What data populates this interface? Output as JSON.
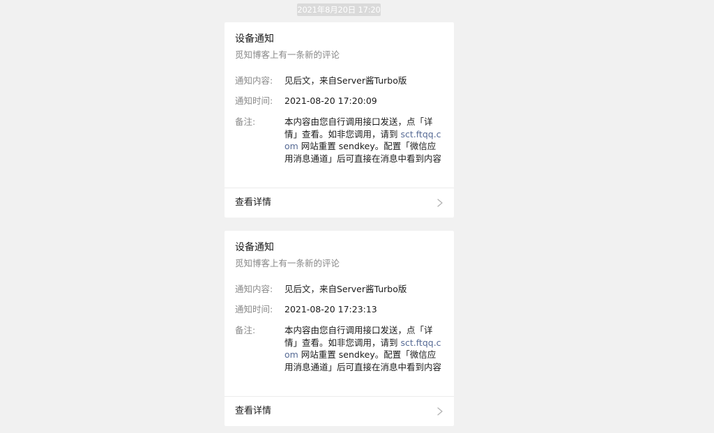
{
  "timestamp": "2021年8月20日 17:20",
  "cards": [
    {
      "title": "设备通知",
      "subtitle": "觅知博客上有一条新的评论",
      "content_label": "通知内容:",
      "content_value": "见后文，来自Server酱Turbo版",
      "time_label": "通知时间:",
      "time_value": "2021-08-20 17:20:09",
      "note_label": "备注:",
      "note_text_1": "本内容由您自行调用接口发送，点「详情」查看。如非您调用，请到 ",
      "note_link": "sct.ftqq.com",
      "note_text_2": " 网站重置 sendkey。配置「微信应用消息通道」后可直接在消息中看到内容",
      "detail_label": "查看详情"
    },
    {
      "title": "设备通知",
      "subtitle": "觅知博客上有一条新的评论",
      "content_label": "通知内容:",
      "content_value": "见后文，来自Server酱Turbo版",
      "time_label": "通知时间:",
      "time_value": "2021-08-20 17:23:13",
      "note_label": "备注:",
      "note_text_1": "本内容由您自行调用接口发送，点「详情」查看。如非您调用，请到 ",
      "note_link": "sct.ftqq.com",
      "note_text_2": " 网站重置 sendkey。配置「微信应用消息通道」后可直接在消息中看到内容",
      "detail_label": "查看详情"
    }
  ],
  "colors": {
    "background": "#f1f1f1",
    "card": "#ffffff",
    "link": "#576b95",
    "label": "#8a8a8a",
    "timestamp_bg": "#dadada"
  },
  "icons": {
    "detail_arrow": "chevron-right-icon"
  }
}
